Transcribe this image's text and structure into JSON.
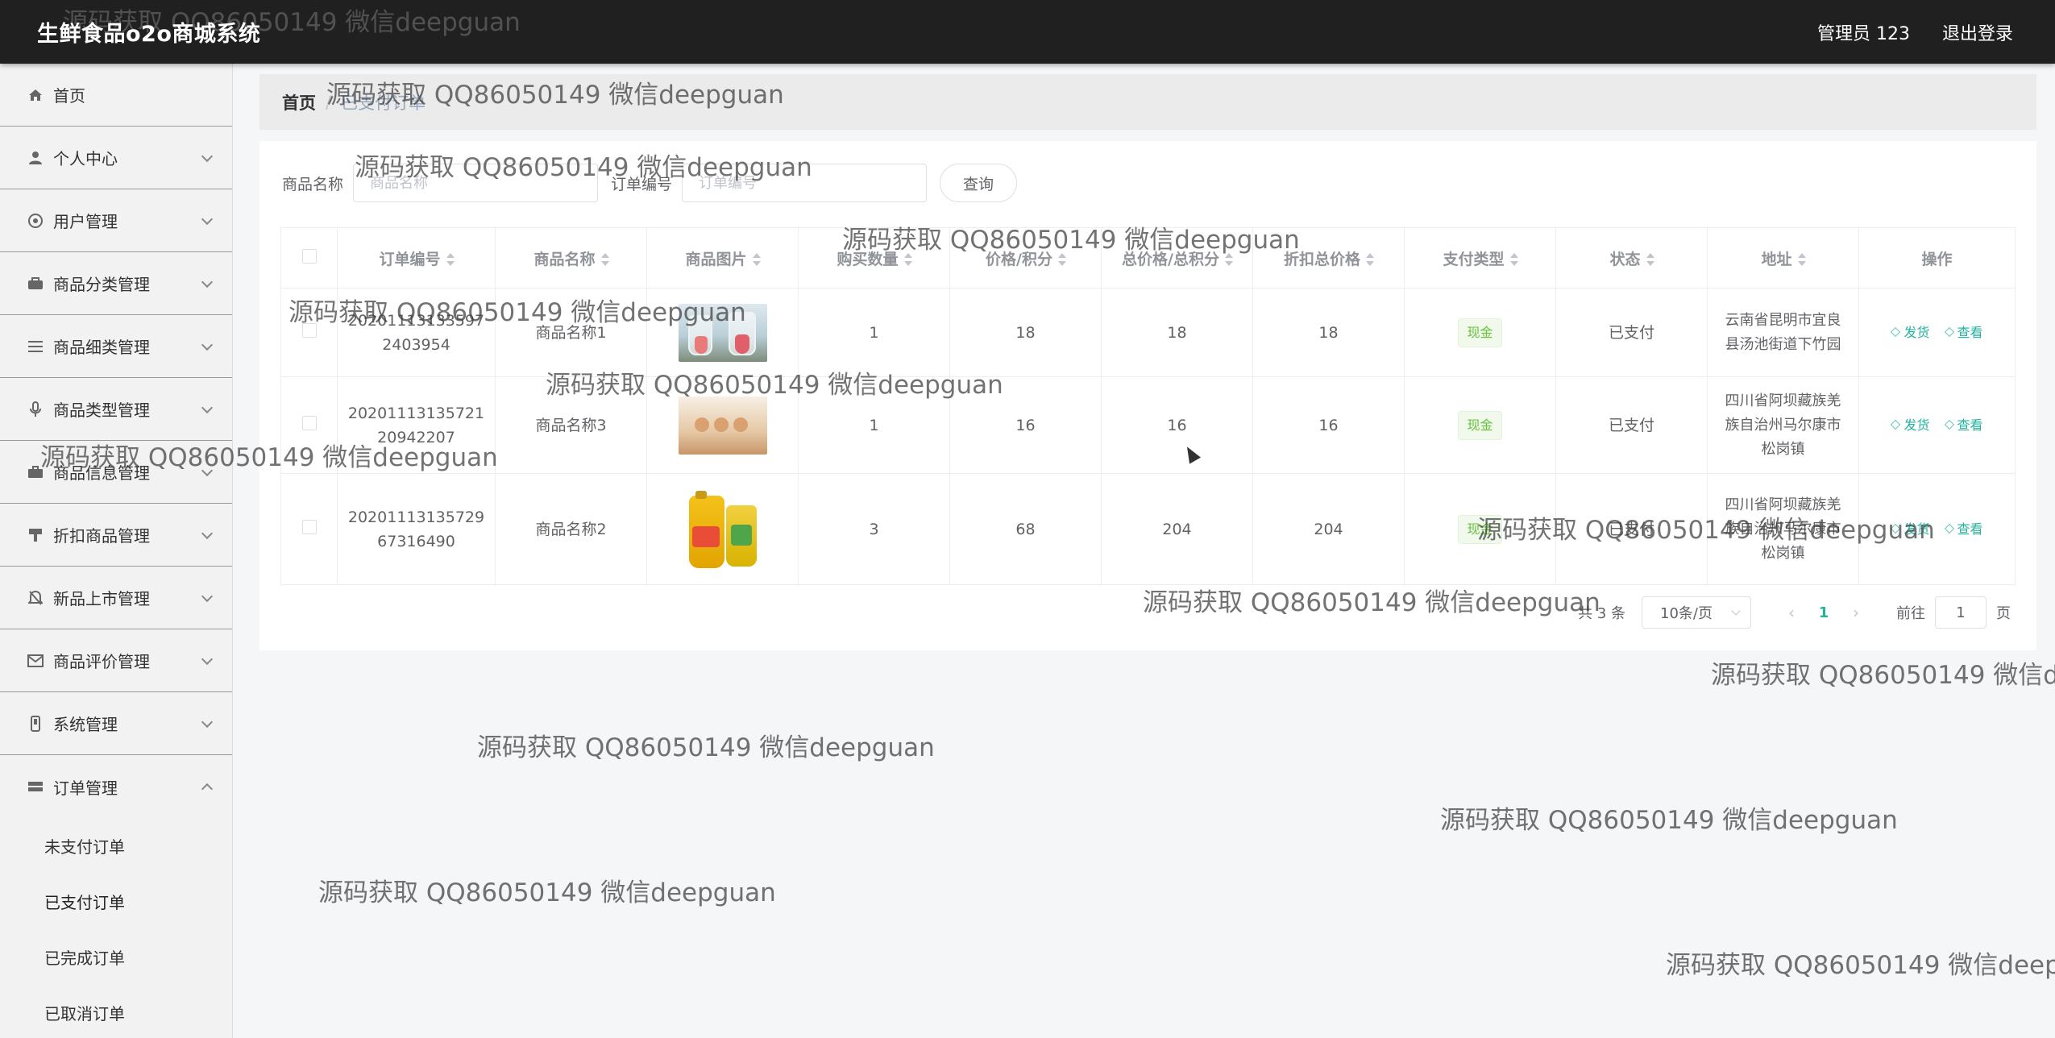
{
  "header": {
    "title": "生鲜食品o2o商城系统",
    "user_label": "管理员 123",
    "logout_label": "退出登录"
  },
  "sidebar": {
    "items": [
      {
        "label": "首页",
        "icon": "home-icon"
      },
      {
        "label": "个人中心",
        "icon": "user-icon"
      },
      {
        "label": "用户管理",
        "icon": "users-icon"
      },
      {
        "label": "商品分类管理",
        "icon": "category-icon"
      },
      {
        "label": "商品细类管理",
        "icon": "list-icon"
      },
      {
        "label": "商品类型管理",
        "icon": "mic-icon"
      },
      {
        "label": "商品信息管理",
        "icon": "briefcase-icon"
      },
      {
        "label": "折扣商品管理",
        "icon": "tag-icon"
      },
      {
        "label": "新品上市管理",
        "icon": "bell-icon"
      },
      {
        "label": "商品评价管理",
        "icon": "mail-icon"
      },
      {
        "label": "系统管理",
        "icon": "settings-icon"
      },
      {
        "label": "订单管理",
        "icon": "order-icon"
      }
    ],
    "sub_items": [
      {
        "label": "未支付订单"
      },
      {
        "label": "已支付订单"
      },
      {
        "label": "已完成订单"
      },
      {
        "label": "已取消订单"
      }
    ]
  },
  "breadcrumb": {
    "home": "首页",
    "current": "已支付订单"
  },
  "filters": {
    "product_label": "商品名称",
    "product_placeholder": "商品名称",
    "order_label": "订单编号",
    "order_placeholder": "订单编号",
    "search_label": "查询"
  },
  "table": {
    "columns": [
      "订单编号",
      "商品名称",
      "商品图片",
      "购买数量",
      "价格/积分",
      "总价格/总积分",
      "折扣总价格",
      "支付类型",
      "状态",
      "地址",
      "操作"
    ],
    "rows": [
      {
        "order_no_a": "20201113133597",
        "order_no_b": "2403954",
        "name": "商品名称1",
        "qty": "1",
        "price": "18",
        "total": "18",
        "discount": "18",
        "pay": "现金",
        "status": "已支付",
        "addr_1": "云南省昆明市宜良",
        "addr_2": "县汤池街道下竹园",
        "addr_3": ""
      },
      {
        "order_no_a": "20201113135721",
        "order_no_b": "20942207",
        "name": "商品名称3",
        "qty": "1",
        "price": "16",
        "total": "16",
        "discount": "16",
        "pay": "现金",
        "status": "已支付",
        "addr_1": "四川省阿坝藏族羌",
        "addr_2": "族自治州马尔康市",
        "addr_3": "松岗镇"
      },
      {
        "order_no_a": "20201113135729",
        "order_no_b": "67316490",
        "name": "商品名称2",
        "qty": "3",
        "price": "68",
        "total": "204",
        "discount": "204",
        "pay": "现金",
        "status": "已支付",
        "addr_1": "四川省阿坝藏族羌",
        "addr_2": "族自治州马尔康市",
        "addr_3": "松岗镇"
      }
    ],
    "ship_label": "发货",
    "view_label": "查看"
  },
  "pagination": {
    "total": "共 3 条",
    "page_size": "10条/页",
    "current_page": "1",
    "goto_label": "前往",
    "goto_value": "1",
    "page_suffix": "页",
    "prev": "‹",
    "next": "›"
  },
  "watermark": "源码获取 QQ86050149 微信deepguan"
}
